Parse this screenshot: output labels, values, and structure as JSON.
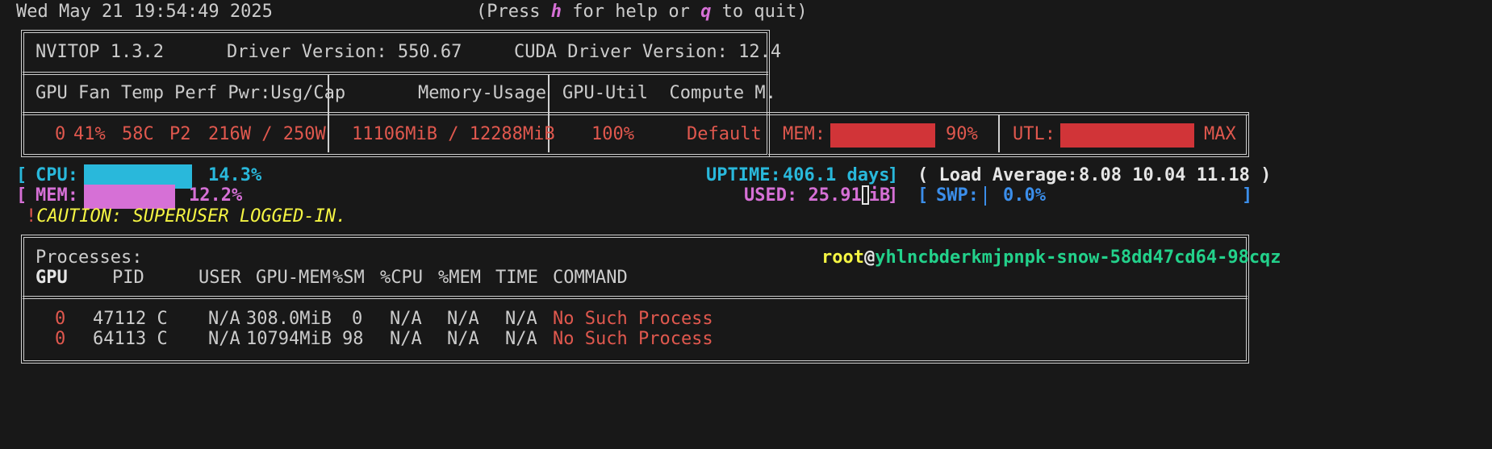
{
  "header": {
    "datetime": "Wed May 21 19:54:49 2025",
    "help_open": "(Press ",
    "help_key": "h",
    "help_mid": " for help or ",
    "quit_key": "q",
    "help_close": " to quit)"
  },
  "gpu_table": {
    "version": "NVITOP 1.3.2",
    "driver": "Driver Version: 550.67",
    "cuda": "CUDA Driver Version: 12.4",
    "col1": "GPU Fan Temp Perf Pwr:Usg/Cap",
    "col2": "Memory-Usage",
    "col3": "GPU-Util  Compute M.",
    "row": {
      "gpu": "0",
      "fan": "41%",
      "temp": "58C",
      "perf": "P2",
      "power": "216W / 250W",
      "memory": "11106MiB / 12288MiB",
      "util": "100%",
      "compute": "Default",
      "mem_label": "MEM:",
      "mem_pct": "90%",
      "mem_fraction": 0.9,
      "utl_label": "UTL:",
      "utl_value": "MAX",
      "utl_fraction": 1.0
    }
  },
  "host": {
    "cpu_label": "CPU:",
    "cpu_pct": "14.3%",
    "cpu_fraction": 0.143,
    "mem_label": "MEM:",
    "mem_pct": "12.2%",
    "mem_fraction": 0.122,
    "uptime_label": "UPTIME:",
    "uptime_value": "406.1 days",
    "load_label": "( Load Average:",
    "load_values": "8.08 10.04 11.18 )",
    "used_label": "USED:",
    "used_before": "25.91",
    "used_cursor_char": "G",
    "used_after": "iB",
    "swp_label": "SWP:",
    "swp_pct": "0.0%",
    "caution_mark": "!",
    "caution_text": "CAUTION: SUPERUSER LOGGED-IN."
  },
  "processes": {
    "title": "Processes:",
    "user": "root",
    "at": "@",
    "hostname": "yhlncbderkmjpnpk-snow-58dd47cd64-98cqz",
    "headers": {
      "gpu": "GPU",
      "pid": "PID",
      "user": "USER",
      "gpu_mem": "GPU-MEM",
      "sm": "%SM",
      "cpu": "%CPU",
      "mem": "%MEM",
      "time": "TIME",
      "command": "COMMAND"
    },
    "rows": [
      {
        "gpu": "0",
        "pid": "47112 C",
        "user": "N/A",
        "gpu_mem": "308.0MiB",
        "sm": "0",
        "cpu": "N/A",
        "mem": "N/A",
        "time": "N/A",
        "command": "No Such Process"
      },
      {
        "gpu": "0",
        "pid": "64113 C",
        "user": "N/A",
        "gpu_mem": "10794MiB",
        "sm": "98",
        "cpu": "N/A",
        "mem": "N/A",
        "time": "N/A",
        "command": "No Such Process"
      }
    ]
  },
  "colors": {
    "bar_red": "#d13438",
    "bar_cyan": "#29b8db",
    "bar_magenta": "#d670d6"
  }
}
